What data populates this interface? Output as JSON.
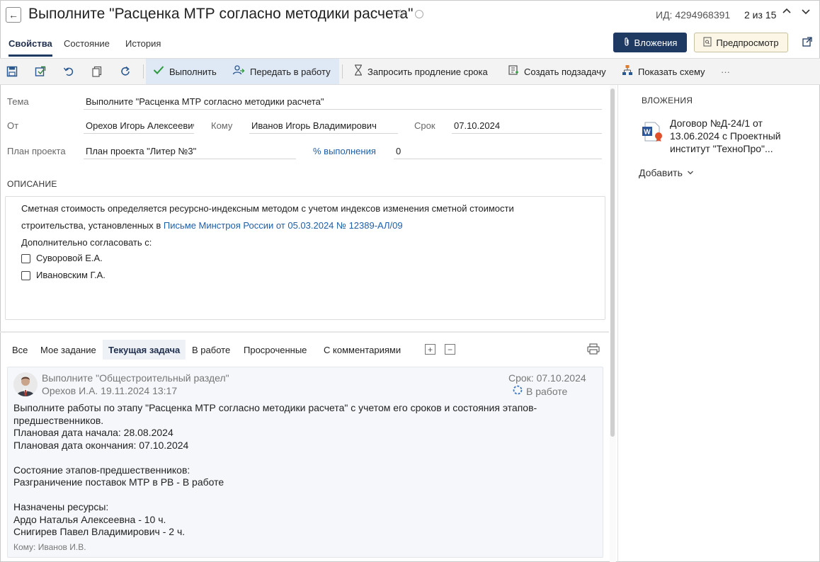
{
  "header": {
    "title": "Выполните \"Расценка МТР согласно методики расчета\"",
    "id_label": "ИД: 4294968391",
    "counter": "2 из 15",
    "tabs": [
      "Свойства",
      "Состояние",
      "История"
    ],
    "attachments_button": "Вложения",
    "preview_button": "Предпросмотр"
  },
  "toolbar": {
    "complete": "Выполнить",
    "send_to_work": "Передать в работу",
    "request_extension": "Запросить продление срока",
    "create_subtask": "Создать подзадачу",
    "show_scheme": "Показать схему",
    "more": "···"
  },
  "form": {
    "subject_label": "Тема",
    "subject_value": "Выполните \"Расценка МТР согласно методики расчета\"",
    "from_label": "От",
    "from_value": "Орехов Игорь Алексеевич",
    "to_label": "Кому",
    "to_value": "Иванов Игорь Владимирович",
    "deadline_label": "Срок",
    "deadline_value": "07.10.2024",
    "plan_label": "План проекта",
    "plan_value": "План проекта \"Литер №3\"",
    "percent_label": "% выполнения",
    "percent_value": "0"
  },
  "description": {
    "title": "ОПИСАНИЕ",
    "line1": "Сметная стоимость определяется ресурсно-индексным методом с учетом индексов изменения сметной стоимости",
    "line2_prefix": "строительства, установленных в ",
    "line2_link": "Письме Минстроя России от 05.03.2024 № 12389-АЛ/09",
    "line3": "Дополнительно согласовать с:",
    "checks": [
      "Суворовой Е.А.",
      "Ивановским Г.А."
    ]
  },
  "filters": {
    "tabs": [
      "Все",
      "Мое задание",
      "Текущая задача",
      "В работе",
      "Просроченные",
      "С комментариями"
    ],
    "expand": "+",
    "collapse": "−"
  },
  "task_card": {
    "title": "Выполните \"Общестроительный раздел\"",
    "author": "Орехов И.А.   19.11.2024 13:17",
    "deadline": "Срок: 07.10.2024",
    "status": "В работе",
    "body": [
      "Выполните работы по этапу \"Расценка МТР согласно методики расчета\" с учетом его сроков и состояния этапов-",
      "предшественников.",
      "Плановая дата начала: 28.08.2024",
      "Плановая дата окончания: 07.10.2024",
      "",
      "Состояние этапов-предшественников:",
      "Разграничение поставок МТР в РВ  - В работе",
      "",
      "Назначены ресурсы:",
      "Ардо Наталья Алексеевна - 10 ч.",
      "Снигирев Павел Владимирович - 2 ч."
    ],
    "to": "Кому: Иванов И.В."
  },
  "attachments": {
    "title": "ВЛОЖЕНИЯ",
    "doc_line1": "Договор №Д-24/1 от",
    "doc_line2": "13.06.2024 с Проектный",
    "doc_line3": "институт \"ТехноПро\"...",
    "add": "Добавить"
  }
}
